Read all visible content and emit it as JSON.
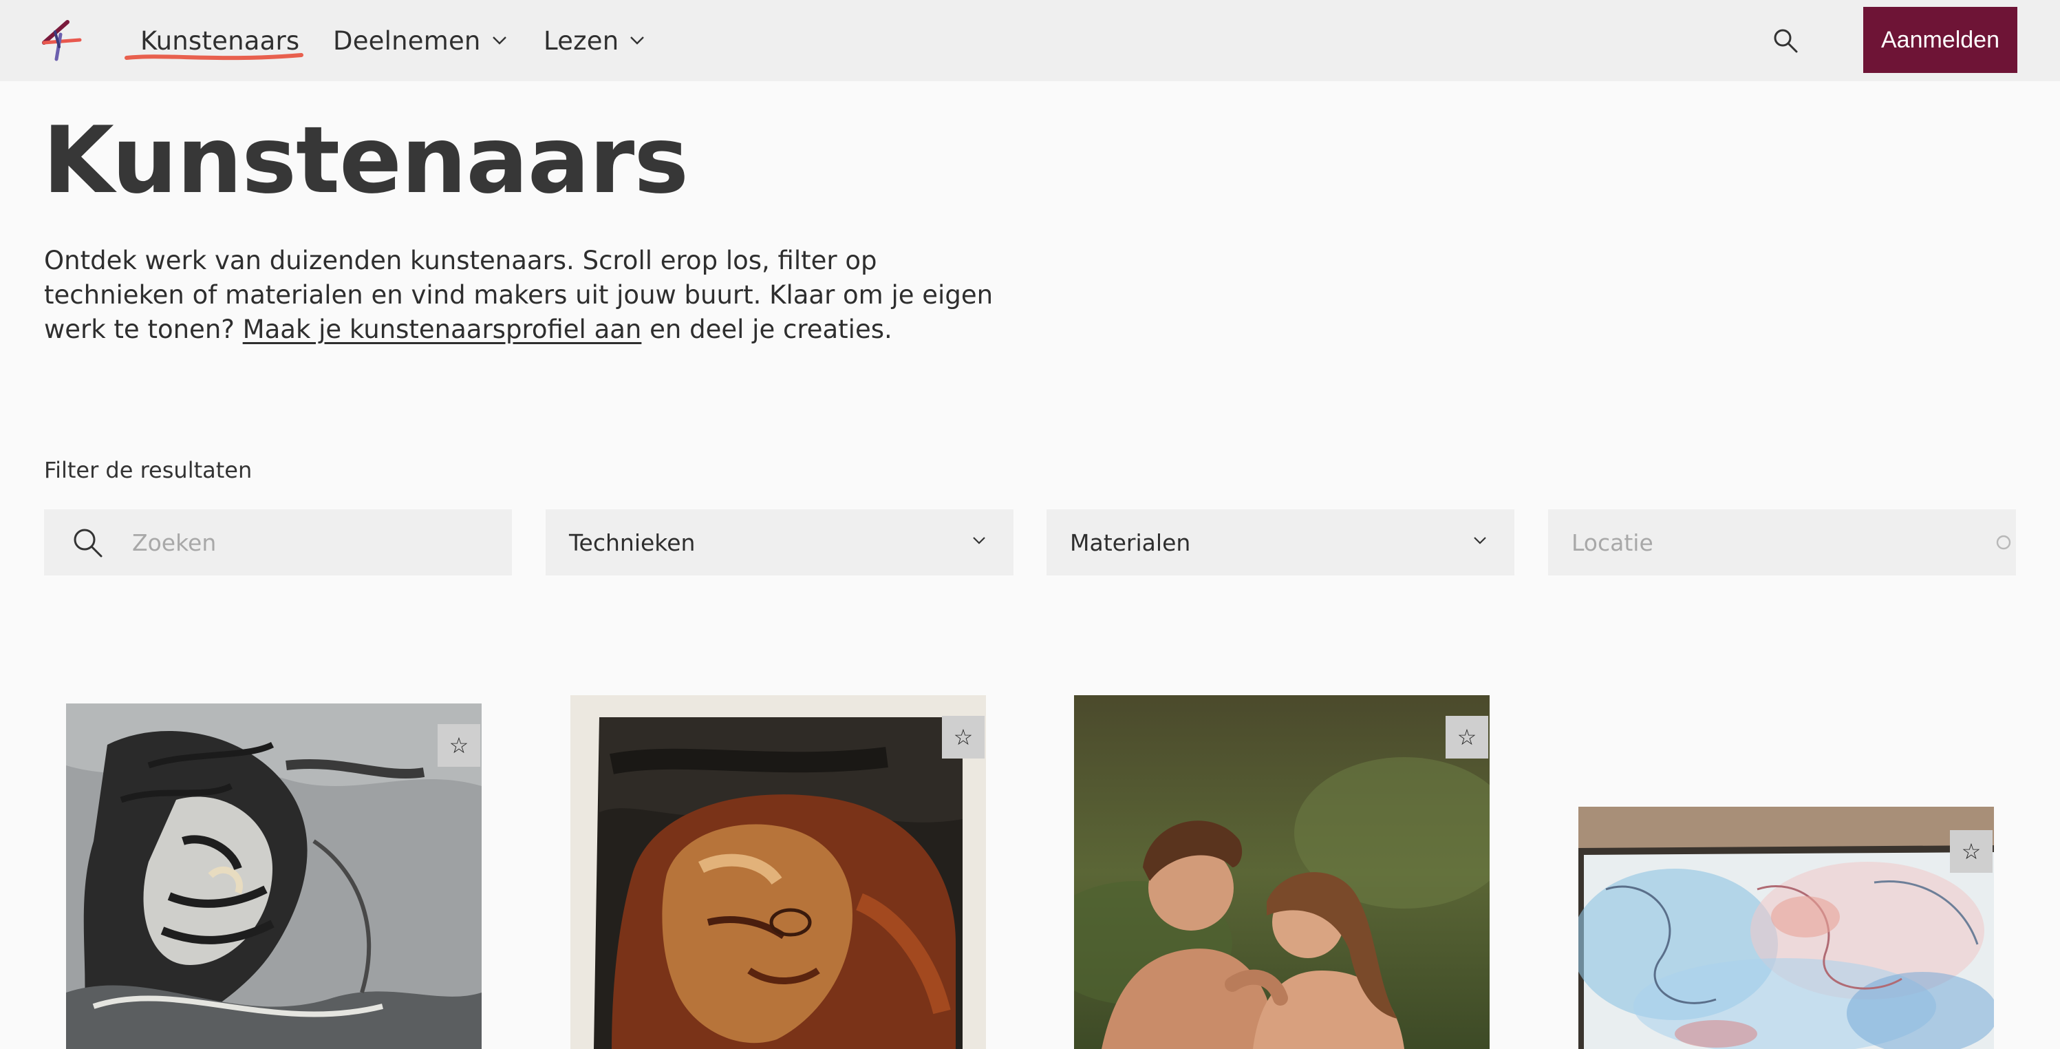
{
  "header": {
    "logo_icon": "logo-icon",
    "nav": [
      {
        "label": "Kunstenaars",
        "active": true
      },
      {
        "label": "Deelnemen",
        "dropdown": true
      },
      {
        "label": "Lezen",
        "dropdown": true
      }
    ],
    "search_icon": "search-icon",
    "signin_label": "Aanmelden",
    "accent_color": "#6e1436"
  },
  "hero": {
    "title": "Kunstenaars",
    "intro_text": "Ontdek werk van duizenden kunstenaars. Scroll erop los, filter op technieken of materialen en vind makers uit jouw buurt. Klaar om je eigen werk te tonen? ",
    "intro_link": "Maak je kunstenaarsprofiel aan",
    "intro_suffix": " en deel je creaties."
  },
  "filters": {
    "label": "Filter de resultaten",
    "search_placeholder": "Zoeken",
    "techniques_label": "Technieken",
    "materials_label": "Materialen",
    "location_placeholder": "Locatie"
  },
  "artworks": [
    {
      "favorite_icon": "star-icon",
      "favorite_glyph": "☆"
    },
    {
      "favorite_icon": "star-icon",
      "favorite_glyph": "☆"
    },
    {
      "favorite_icon": "star-icon",
      "favorite_glyph": "☆"
    },
    {
      "favorite_icon": "star-icon",
      "favorite_glyph": "☆"
    }
  ]
}
